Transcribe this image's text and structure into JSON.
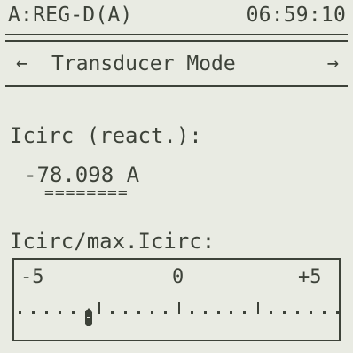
{
  "status_bar": {
    "register": "A:REG-D(A)",
    "time": "06:59:10"
  },
  "mode_nav": {
    "left_arrow": "←",
    "title": "Transducer Mode",
    "right_arrow": "→"
  },
  "measurement": {
    "label": "Icirc (react.):",
    "value": "-78.098 A",
    "underline": "========"
  },
  "ratio_gauge": {
    "label": "Icirc/max.Icirc:",
    "scale_min": "-5",
    "scale_mid": "0",
    "scale_max": "+5",
    "pointer_value": -2.8,
    "range": [
      -5,
      5
    ]
  },
  "colors": {
    "lcd_background": "#e9ebe3",
    "lcd_foreground": "#3d4239"
  }
}
